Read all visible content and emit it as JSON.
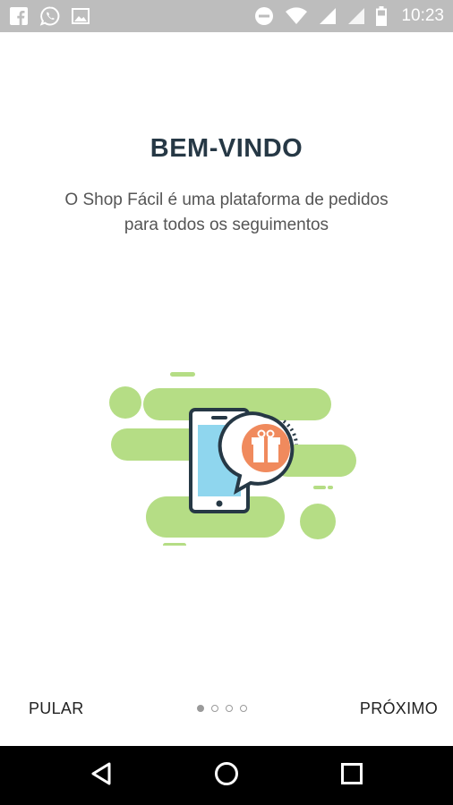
{
  "status_bar": {
    "time": "10:23",
    "left_icons": [
      "facebook-icon",
      "whatsapp-icon",
      "image-icon"
    ],
    "right_icons": [
      "do-not-disturb-icon",
      "wifi-icon",
      "signal-icon",
      "signal-icon",
      "battery-icon"
    ]
  },
  "onboarding": {
    "title": "BEM-VINDO",
    "subtitle_line1": "O Shop Fácil é uma plataforma de pedidos",
    "subtitle_line2": "para todos os seguimentos",
    "skip_label": "PULAR",
    "next_label": "PRÓXIMO",
    "page_count": 4,
    "current_page": 1
  },
  "colors": {
    "title": "#263845",
    "blob": "#b5dd85",
    "phone_screen": "#8fd6ee",
    "gift_orange": "#f08a5d",
    "outline": "#263845"
  },
  "nav_bar": {
    "buttons": [
      "back-icon",
      "home-icon",
      "recents-icon"
    ]
  }
}
